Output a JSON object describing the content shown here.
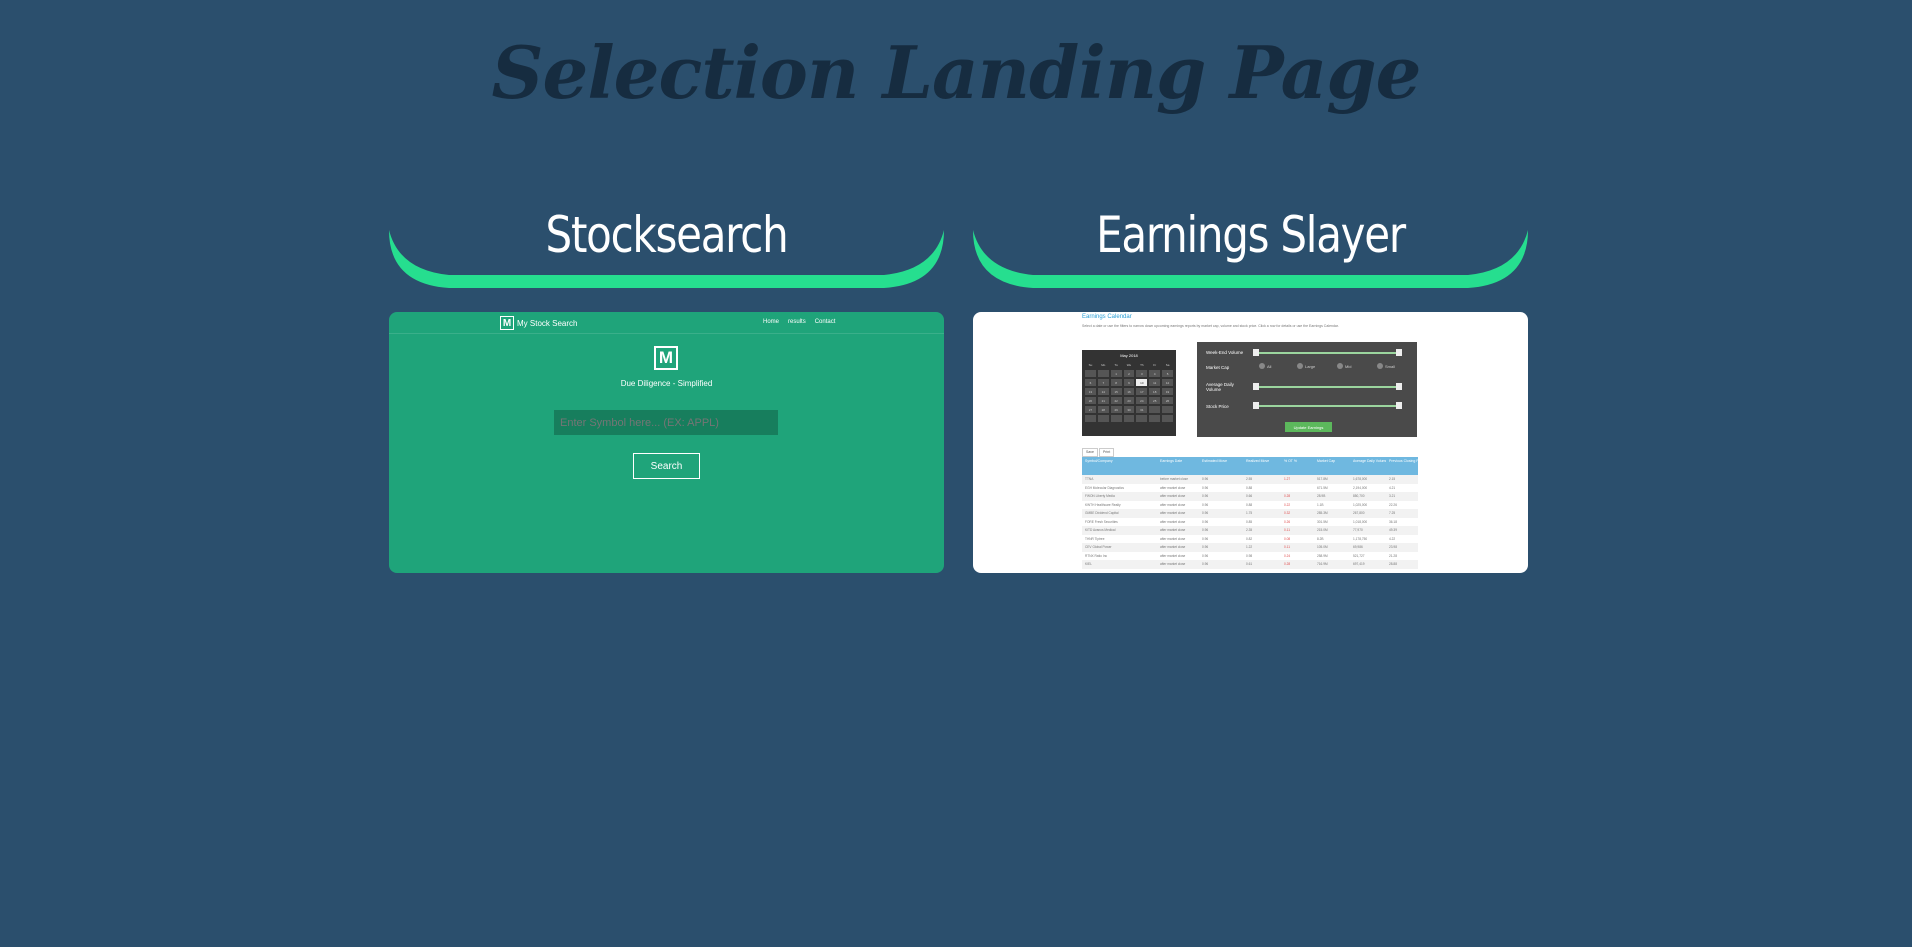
{
  "page": {
    "title": "Selection Landing Page"
  },
  "theme": {
    "background": "#2b4f6d",
    "title_color": "#162c40",
    "accent": "#26de8f",
    "card_green": "#1fa47a"
  },
  "cards": [
    {
      "heading": "Stocksearch",
      "preview": {
        "brand": "My Stock Search",
        "logo_letter": "M",
        "nav": [
          "Home",
          "results",
          "Contact"
        ],
        "tagline": "Due Diligence - Simplified",
        "input_placeholder": "Enter Symbol here... (EX: APPL)",
        "button": "Search"
      }
    },
    {
      "heading": "Earnings Slayer",
      "preview": {
        "title": "Earnings Calendar",
        "description": "Select a date or use the filters to narrow down upcoming earnings reports by market cap, volume and stock price. Click a row for details or use the Earnings Calendar.",
        "calendar_header": "May 2018",
        "calendar_dow": [
          "Su",
          "Mo",
          "Tu",
          "We",
          "Th",
          "Fr",
          "Sa"
        ],
        "filters": [
          "Week-End Volume",
          "Market Cap",
          "Average Daily Volume",
          "Stock Price"
        ],
        "cap_options": [
          "All",
          "Large",
          "Mid",
          "Small"
        ],
        "update_button": "Update Earnings",
        "table_tabs": [
          "Save",
          "Print"
        ],
        "table_headers": [
          "Symbol/Company",
          "Earnings Date",
          "Estimated Move",
          "Realized Move",
          "% OT %",
          "Market Cap",
          "Average Daily Volume",
          "Previous Closing Price"
        ],
        "table_rows": [
          [
            "TTNA",
            "before market close",
            "0.96",
            "2.55",
            "1.27",
            "517.8M",
            "1,678,000",
            "2.15"
          ],
          [
            "EGH Molecular Diagnostics",
            "after market close",
            "0.96",
            "0.88",
            "",
            "671.5M",
            "2,194,000",
            "4.21"
          ],
          [
            "FWON Liberty Media",
            "after market close",
            "0.96",
            "0.66",
            "0.28",
            "28.9B",
            "850,700",
            "3.21"
          ],
          [
            "KWTH Healthcare Realty",
            "after market close",
            "0.96",
            "0.88",
            "0.22",
            "1.1B",
            "1,025,000",
            "22.26"
          ],
          [
            "GMBE Dividend Capital",
            "after market close",
            "0.96",
            "1.75",
            "0.32",
            "285.3M",
            "267,800",
            "7.25"
          ],
          [
            "FORE Fresh Securities",
            "after market close",
            "0.96",
            "0.85",
            "0.26",
            "301.5M",
            "1,018,000",
            "36.18"
          ],
          [
            "KITD Avanos Medical",
            "after market close",
            "0.96",
            "2.35",
            "0.11",
            "215.0M",
            "77,970",
            "49.39"
          ],
          [
            "THNR Tiptree",
            "after market close",
            "0.96",
            "0.82",
            "0.08",
            "8.2B",
            "1,178,750",
            "4.22"
          ],
          [
            "CEV Global Power",
            "after market close",
            "0.96",
            "1.22",
            "0.11",
            "105.0M",
            "69,986",
            "23.98"
          ],
          [
            "RTNX Ratio Inc",
            "after market close",
            "0.96",
            "0.98",
            "0.24",
            "258.9M",
            "521,727",
            "21.28"
          ],
          [
            "KIEL",
            "after market close",
            "0.96",
            "0.61",
            "0.28",
            "716.9M",
            "697,419",
            "28.88"
          ]
        ]
      }
    }
  ]
}
